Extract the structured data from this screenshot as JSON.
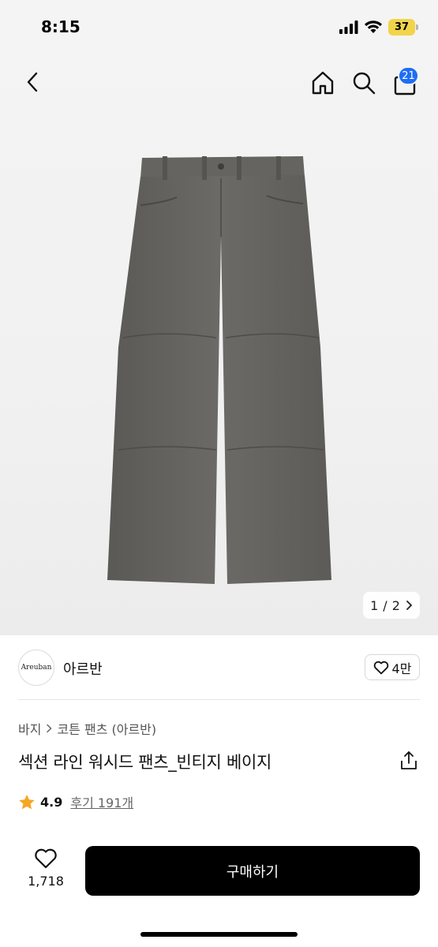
{
  "status_bar": {
    "time": "8:15",
    "battery": "37"
  },
  "nav": {
    "cart_badge": "21"
  },
  "gallery": {
    "current": "1",
    "separator": "/",
    "total": "2"
  },
  "brand": {
    "logo_text": "Areuban",
    "name": "아르반",
    "likes": "4만"
  },
  "breadcrumb": {
    "category": "바지",
    "subcategory": "코튼 팬츠 (아르반)"
  },
  "product": {
    "title": "섹션 라인 워시드 팬츠_빈티지 베이지"
  },
  "rating": {
    "value": "4.9",
    "reviews": "후기 191개"
  },
  "bottom": {
    "wish_count": "1,718",
    "buy_label": "구매하기"
  },
  "colors": {
    "accent": "#1d6ef5",
    "star": "#f5a623",
    "button": "#000000",
    "battery": "#f2d44a"
  },
  "icons": [
    "back-icon",
    "home-icon",
    "search-icon",
    "cart-icon",
    "chevron-right-icon",
    "heart-icon",
    "share-icon",
    "star-icon"
  ]
}
